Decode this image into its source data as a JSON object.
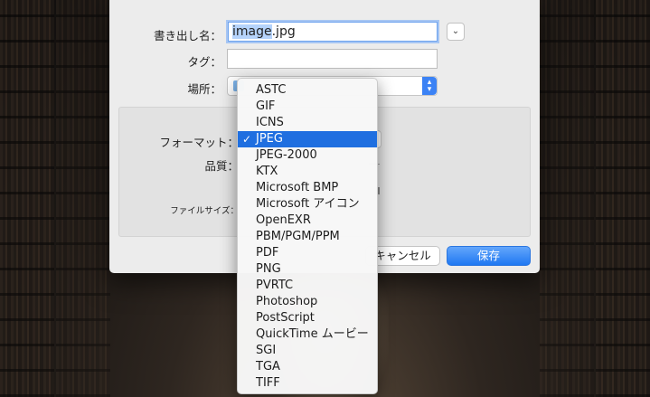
{
  "dialog": {
    "name_label": "書き出し名：",
    "name_selected_part": "image",
    "name_rest": ".jpg",
    "tag_label": "タグ：",
    "tag_value": "",
    "location_label": "場所：",
    "format_label": "フォーマット：",
    "quality_label": "品質：",
    "filesize_label": "ファイルサイズ：",
    "cancel_label": "キャンセル",
    "save_label": "保存",
    "expand_glyph": "⌄"
  },
  "format_menu": {
    "selected": "JPEG",
    "check_glyph": "✓",
    "items": [
      "ASTC",
      "GIF",
      "ICNS",
      "JPEG",
      "JPEG-2000",
      "KTX",
      "Microsoft BMP",
      "Microsoft アイコン",
      "OpenEXR",
      "PBM/PGM/PPM",
      "PDF",
      "PNG",
      "PVRTC",
      "Photoshop",
      "PostScript",
      "QuickTime ムービー",
      "SGI",
      "TGA",
      "TIFF"
    ]
  },
  "colors": {
    "accent": "#1f6fe0",
    "dialog_bg": "#ececec",
    "menu_bg": "#f7f7f7"
  }
}
